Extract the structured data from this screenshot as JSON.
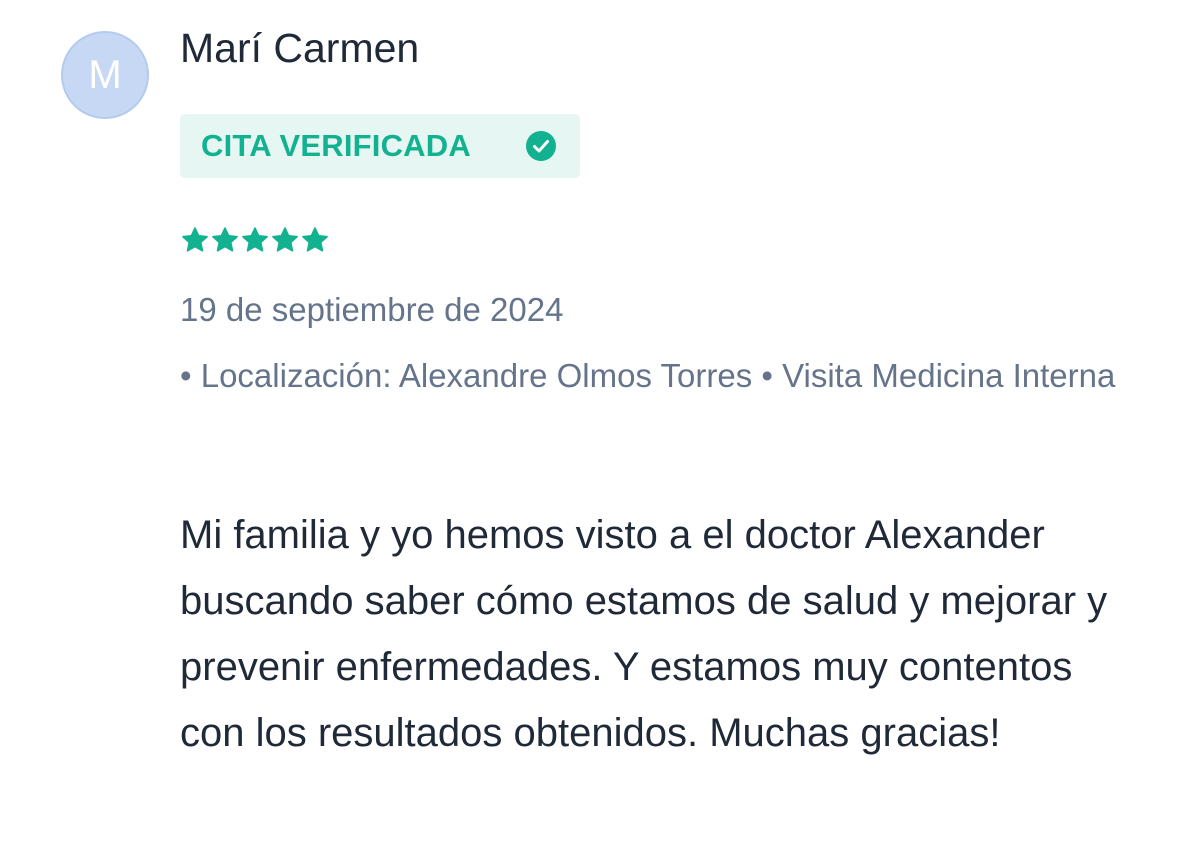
{
  "review": {
    "avatar_initial": "M",
    "author_name": "Marí Carmen",
    "verified_label": "CITA VERIFICADA",
    "rating": 5,
    "rating_max": 5,
    "date": "19 de septiembre de 2024",
    "details_line": "• Localización: Alexandre Olmos Torres • Visita Medicina Interna",
    "text": "Mi familia y yo hemos visto a el doctor Alexander buscando saber cómo estamos de salud y mejorar y prevenir enfermedades. Y estamos muy contentos con los resultados obtenidos. Muchas gracias!"
  },
  "colors": {
    "accent": "#12b18f",
    "badge_background": "#e6f7f3",
    "avatar_background": "#c6d8f4",
    "muted_text": "#65748b",
    "body_text": "#1f2937"
  },
  "icons": {
    "verified": "check-circle-icon",
    "rating": "star-icon"
  }
}
